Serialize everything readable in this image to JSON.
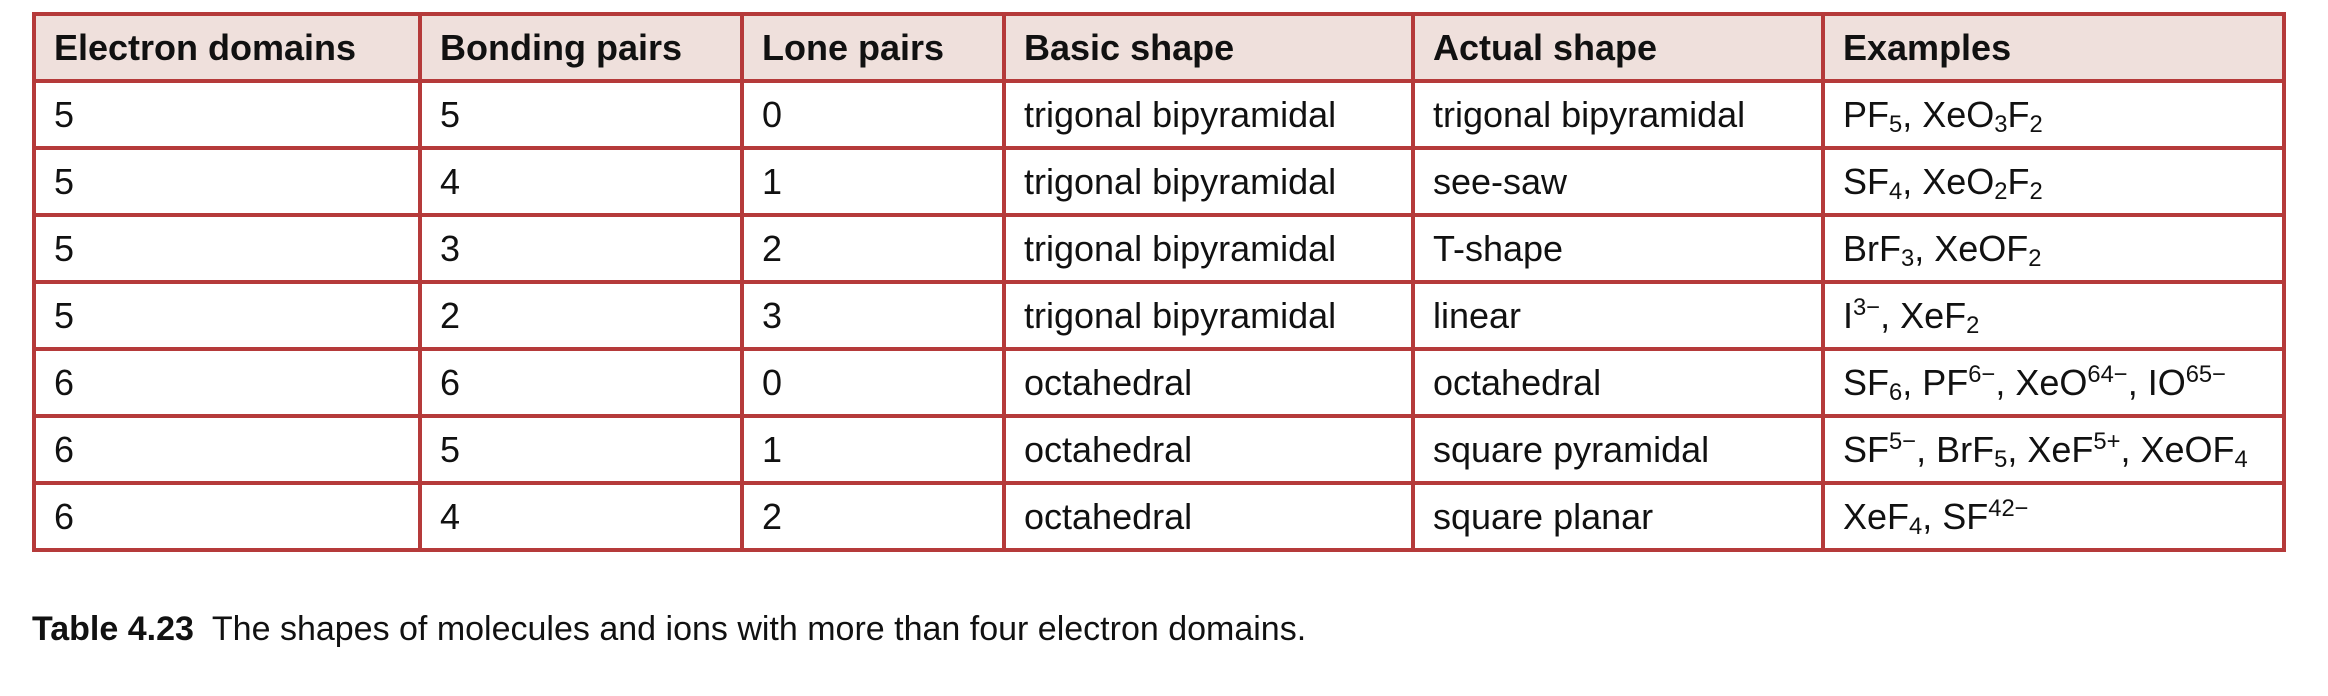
{
  "table": {
    "headers": [
      "Electron domains",
      "Bonding pairs",
      "Lone pairs",
      "Basic shape",
      "Actual shape",
      "Examples"
    ],
    "rows": [
      {
        "domains": "5",
        "bonding": "5",
        "lone": "0",
        "basic": "trigonal bipyramidal",
        "actual": "trigonal bipyramidal",
        "examples": "PF5, XeO3F2"
      },
      {
        "domains": "5",
        "bonding": "4",
        "lone": "1",
        "basic": "trigonal bipyramidal",
        "actual": "see-saw",
        "examples": "SF4, XeO2F2"
      },
      {
        "domains": "5",
        "bonding": "3",
        "lone": "2",
        "basic": "trigonal bipyramidal",
        "actual": "T-shape",
        "examples": "BrF3, XeOF2"
      },
      {
        "domains": "5",
        "bonding": "2",
        "lone": "3",
        "basic": "trigonal bipyramidal",
        "actual": "linear",
        "examples": "I3−, XeF2"
      },
      {
        "domains": "6",
        "bonding": "6",
        "lone": "0",
        "basic": "octahedral",
        "actual": "octahedral",
        "examples": "SF6, PF6−, XeO64−, IO65−"
      },
      {
        "domains": "6",
        "bonding": "5",
        "lone": "1",
        "basic": "octahedral",
        "actual": "square pyramidal",
        "examples": "SF5−, BrF5, XeF5+, XeOF4"
      },
      {
        "domains": "6",
        "bonding": "4",
        "lone": "2",
        "basic": "octahedral",
        "actual": "square planar",
        "examples": "XeF4, SF42−"
      }
    ]
  },
  "caption": {
    "number": "Table 4.23",
    "text": "The shapes of molecules and ions with more than four electron domains."
  }
}
